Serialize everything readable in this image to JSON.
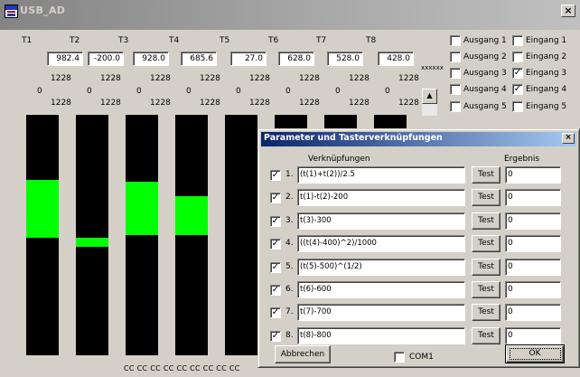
{
  "window": {
    "title": "USB_AD",
    "icon": "app-logo-icon",
    "close_label": "×"
  },
  "channels": [
    {
      "label": "T1",
      "value": "982.4",
      "scale_max": "1228",
      "scale_zero": "0",
      "scale_bottom": "1228",
      "fill_top": 0.27,
      "fill_bottom": 0.51
    },
    {
      "label": "T2",
      "value": "-200.0",
      "scale_max": "1228",
      "scale_zero": "0",
      "scale_bottom": "1228",
      "fill_top": 0.51,
      "fill_bottom": 0.55
    },
    {
      "label": "T3",
      "value": "928.0",
      "scale_max": "1228",
      "scale_zero": "0",
      "scale_bottom": "1228",
      "fill_top": 0.28,
      "fill_bottom": 0.5
    },
    {
      "label": "T4",
      "value": "685.6",
      "scale_max": "1228",
      "scale_zero": "0",
      "scale_bottom": "1228",
      "fill_top": 0.34,
      "fill_bottom": 0.5
    },
    {
      "label": "T5",
      "value": "27.0",
      "scale_max": "1228",
      "scale_zero": "0",
      "scale_bottom": "1228",
      "fill_top": 0.0,
      "fill_bottom": 0.0
    },
    {
      "label": "T6",
      "value": "628.0",
      "scale_max": "1228",
      "scale_zero": "0",
      "scale_bottom": "1228",
      "fill_top": 0.0,
      "fill_bottom": 0.0
    },
    {
      "label": "T7",
      "value": "528.0",
      "scale_max": "1228",
      "scale_zero": "0",
      "scale_bottom": "1228",
      "fill_top": 0.0,
      "fill_bottom": 0.0
    },
    {
      "label": "T8",
      "value": "428.0",
      "scale_max": "1228",
      "scale_zero": "0",
      "scale_bottom": "1228",
      "fill_top": 0.0,
      "fill_bottom": 0.0
    }
  ],
  "colors": {
    "bar_fill": "#00ff00",
    "bar_bg": "#000000",
    "dialog_title": "#0a246a"
  },
  "placeholder_text": "xxxxxx",
  "scroll_up_label": "▲",
  "io": [
    {
      "out_label": "Ausgang 1",
      "out_checked": false,
      "in_label": "Eingang 1",
      "in_checked": false
    },
    {
      "out_label": "Ausgang 2",
      "out_checked": false,
      "in_label": "Eingang 2",
      "in_checked": false
    },
    {
      "out_label": "Ausgang 3",
      "out_checked": false,
      "in_label": "Eingang 3",
      "in_checked": true
    },
    {
      "out_label": "Ausgang 4",
      "out_checked": false,
      "in_label": "Eingang 4",
      "in_checked": true
    },
    {
      "out_label": "Ausgang 5",
      "out_checked": false,
      "in_label": "Eingang 5",
      "in_checked": false
    }
  ],
  "cc_text": "CC CC CC CC CC CC CC CC CC",
  "dialog": {
    "title": "Parameter und Tasterverknüpfungen",
    "close_label": "×",
    "col_expr": "Verknüpfungen",
    "col_result": "Ergebnis",
    "rows": [
      {
        "num": "1.",
        "checked": true,
        "expr": "(t(1)+t(2))/2.5",
        "test_label": "Test",
        "result": "0"
      },
      {
        "num": "2.",
        "checked": true,
        "expr": "t(1)-t(2)-200",
        "test_label": "Test",
        "result": "0"
      },
      {
        "num": "3.",
        "checked": true,
        "expr": "t(3)-300",
        "test_label": "Test",
        "result": "0"
      },
      {
        "num": "4.",
        "checked": true,
        "expr": "((t(4)-400)^2)/1000",
        "test_label": "Test",
        "result": "0"
      },
      {
        "num": "5.",
        "checked": true,
        "expr": "(t(5)-500)^(1/2)",
        "test_label": "Test",
        "result": "0"
      },
      {
        "num": "6.",
        "checked": true,
        "expr": "t(6)-600",
        "test_label": "Test",
        "result": "0"
      },
      {
        "num": "7.",
        "checked": true,
        "expr": "t(7)-700",
        "test_label": "Test",
        "result": "0"
      },
      {
        "num": "8.",
        "checked": true,
        "expr": "t(8)-800",
        "test_label": "Test",
        "result": "0"
      }
    ],
    "cancel_label": "Abbrechen",
    "com_label": "COM1",
    "com_checked": false,
    "ok_label": "OK"
  }
}
